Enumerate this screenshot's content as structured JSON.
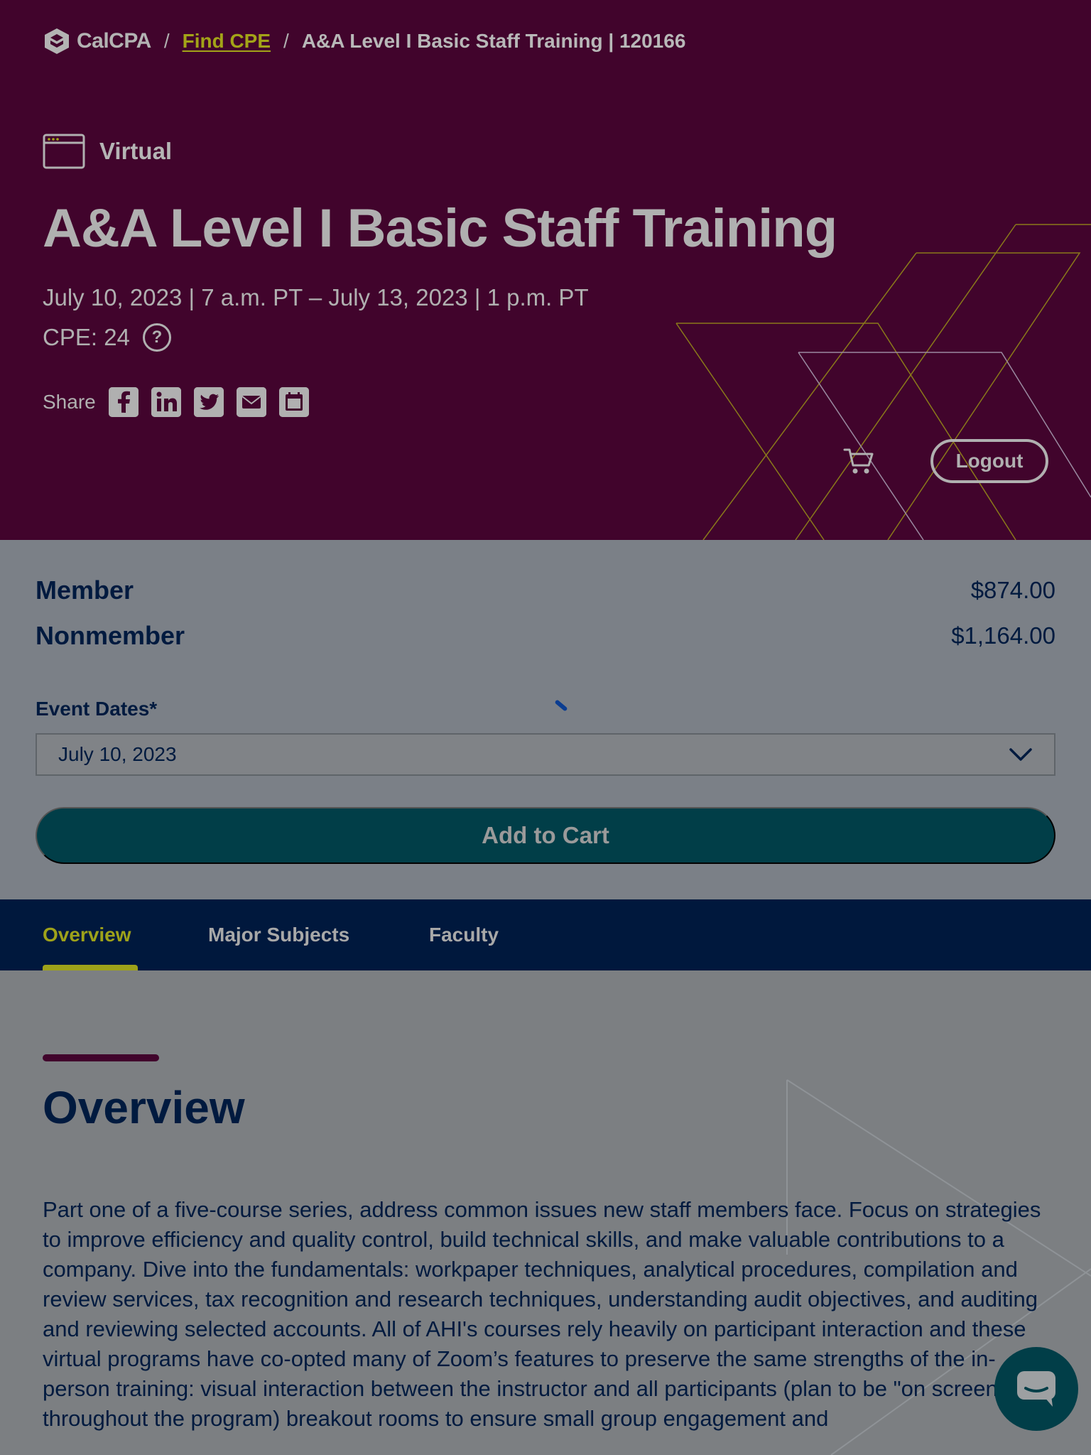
{
  "breadcrumb": {
    "logo": "CalCPA",
    "separator": "/",
    "link": "Find CPE",
    "current": "A&A Level I Basic Staff Training | 120166"
  },
  "event": {
    "format": "Virtual",
    "title": "A&A Level I Basic Staff Training",
    "dates": "July 10, 2023 | 7 a.m. PT – July 13, 2023 | 1 p.m. PT",
    "cpe": "CPE: 24",
    "help_glyph": "?"
  },
  "share": {
    "label": "Share",
    "icons": [
      "facebook-icon",
      "linkedin-icon",
      "twitter-icon",
      "email-icon",
      "calendar-icon"
    ]
  },
  "header_actions": {
    "logout": "Logout",
    "cart_icon": "cart-icon"
  },
  "pricing": {
    "member_label": "Member",
    "member_price": "$874.00",
    "nonmember_label": "Nonmember",
    "nonmember_price": "$1,164.00",
    "dates_label": "Event Dates*",
    "selected_date": "July 10, 2023",
    "add_to_cart": "Add to Cart"
  },
  "tabs": [
    {
      "label": "Overview",
      "active": true
    },
    {
      "label": "Major Subjects",
      "active": false
    },
    {
      "label": "Faculty",
      "active": false
    }
  ],
  "overview": {
    "title": "Overview",
    "body": "Part one of a five-course series, address common issues new staff members face. Focus on strategies to improve efficiency and quality control, build technical skills, and make valuable contributions to a company. Dive into the fundamentals: workpaper techniques, analytical procedures, compilation and review services, tax recognition and research techniques, understanding audit objectives, and auditing and reviewing selected accounts. All of AHI's courses rely heavily on participant interaction and these virtual programs have co-opted many of Zoom’s features to preserve the same strengths of the in-person training: visual interaction between the instructor and all participants (plan to be \"on screen\" throughout the program) breakout rooms to ensure small group engagement and"
  },
  "colors": {
    "hero_bg": "#41042c",
    "accent_link": "#a3a418",
    "tabbar_bg": "#00183d",
    "button_bg": "#013e48",
    "text_navy": "#001a3f"
  }
}
